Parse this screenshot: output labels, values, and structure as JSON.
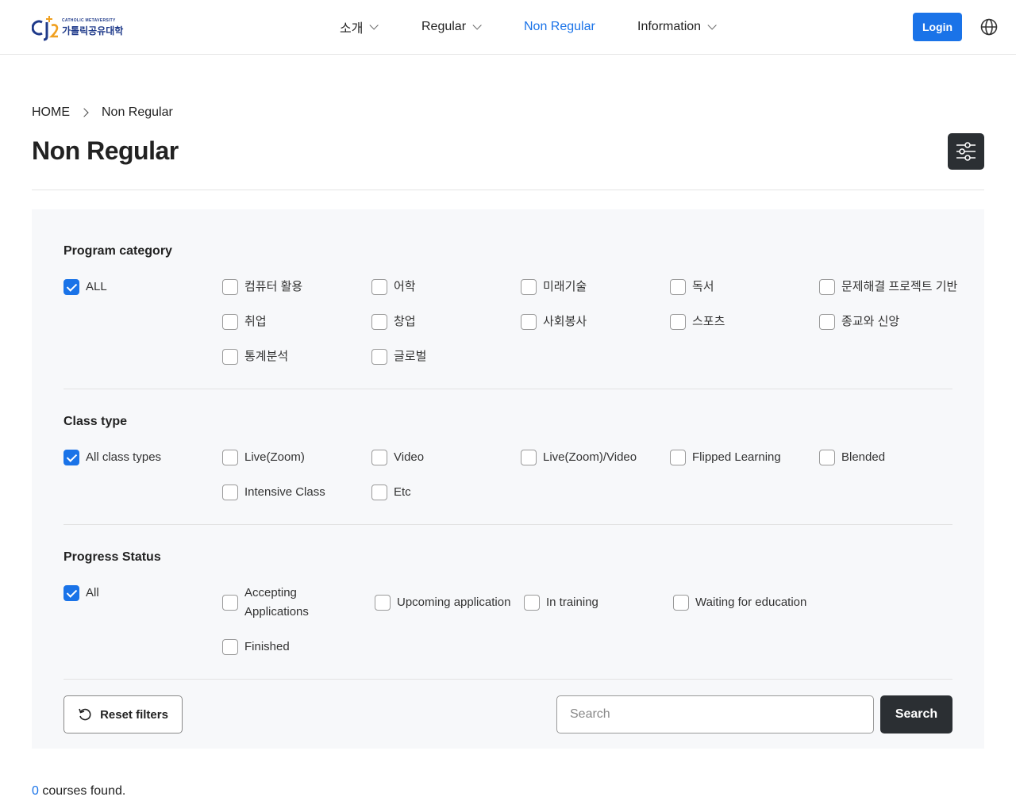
{
  "brand": {
    "sub": "CATHOLIC METAVERSITY",
    "name": "가톨릭공유대학",
    "accent": "#1a73e8",
    "logo_blue": "#1f3a8a",
    "logo_orange": "#f0a020"
  },
  "nav": {
    "items": [
      {
        "label": "소개",
        "has_dropdown": true
      },
      {
        "label": "Regular",
        "has_dropdown": true
      },
      {
        "label": "Non Regular",
        "has_dropdown": false,
        "active": true
      },
      {
        "label": "Information",
        "has_dropdown": true
      }
    ],
    "login_label": "Login",
    "language_icon": "globe-icon"
  },
  "breadcrumb": {
    "home": "HOME",
    "current": "Non Regular"
  },
  "page_title": "Non Regular",
  "filter_toggle_icon": "sliders-icon",
  "filters": {
    "program_category": {
      "title": "Program category",
      "all": {
        "label": "ALL",
        "checked": true
      },
      "options": [
        "컴퓨터 활용",
        "어학",
        "미래기술",
        "독서",
        "문제해결 프로젝트 기반",
        "취업",
        "창업",
        "사회봉사",
        "스포츠",
        "종교와 신앙",
        "통계분석",
        "글로벌"
      ]
    },
    "class_type": {
      "title": "Class type",
      "all": {
        "label": "All class types",
        "checked": true
      },
      "options": [
        "Live(Zoom)",
        "Video",
        "Live(Zoom)/Video",
        "Flipped Learning",
        "Blended",
        "Intensive Class",
        "Etc"
      ]
    },
    "progress_status": {
      "title": "Progress Status",
      "all": {
        "label": "All",
        "checked": true
      },
      "options": [
        "Accepting Applications",
        "Upcoming application",
        "In training",
        "Waiting for education",
        "Finished"
      ]
    }
  },
  "actions": {
    "reset_label": "Reset filters",
    "search_placeholder": "Search",
    "search_label": "Search"
  },
  "results": {
    "count": "0",
    "suffix": " courses found."
  }
}
